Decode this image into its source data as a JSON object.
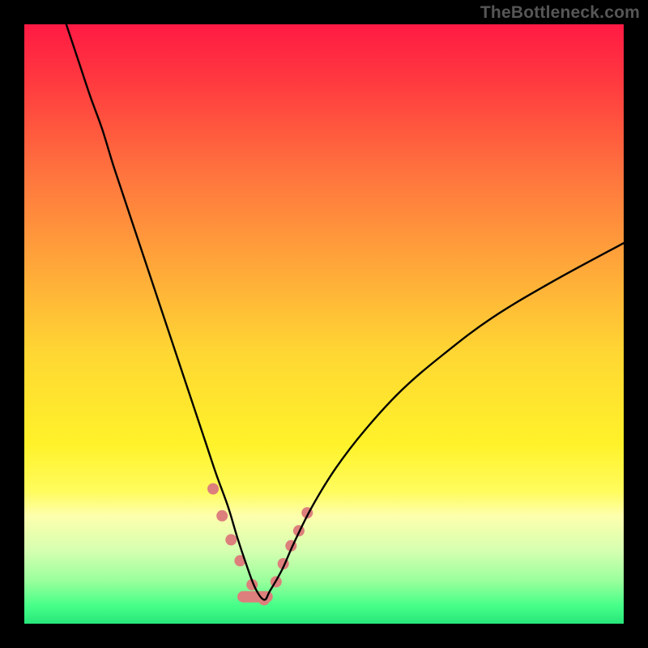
{
  "attribution": "TheBottleneck.com",
  "chart_data": {
    "type": "line",
    "title": "",
    "xlabel": "",
    "ylabel": "",
    "xlim": [
      0,
      100
    ],
    "ylim": [
      0,
      100
    ],
    "grid": false,
    "legend": false,
    "background": {
      "type": "vertical-gradient",
      "stops": [
        {
          "pos": 0.0,
          "color": "#ff1a44"
        },
        {
          "pos": 0.1,
          "color": "#ff3b3f"
        },
        {
          "pos": 0.25,
          "color": "#ff743e"
        },
        {
          "pos": 0.4,
          "color": "#ffa63a"
        },
        {
          "pos": 0.55,
          "color": "#ffd733"
        },
        {
          "pos": 0.7,
          "color": "#fff22a"
        },
        {
          "pos": 0.78,
          "color": "#fffc5e"
        },
        {
          "pos": 0.82,
          "color": "#fdffad"
        },
        {
          "pos": 0.88,
          "color": "#d4ffb0"
        },
        {
          "pos": 0.93,
          "color": "#97ff9b"
        },
        {
          "pos": 0.97,
          "color": "#46ff88"
        },
        {
          "pos": 1.0,
          "color": "#28e67a"
        }
      ]
    },
    "series": [
      {
        "name": "bottleneck-curve",
        "color": "#000000",
        "stroke_width": 2.4,
        "x": [
          7.0,
          9.0,
          11.0,
          13.0,
          15.0,
          18.0,
          21.0,
          24.0,
          27.0,
          30.0,
          32.0,
          34.0,
          35.5,
          37.0,
          38.5,
          40.0,
          41.0,
          43.0,
          45.0,
          48.0,
          52.0,
          57.0,
          63.0,
          70.0,
          78.0,
          88.0,
          100.0
        ],
        "y": [
          100.0,
          94.0,
          88.0,
          82.5,
          76.0,
          67.0,
          58.0,
          49.0,
          40.0,
          31.0,
          25.0,
          19.5,
          14.5,
          10.0,
          6.0,
          4.0,
          5.5,
          9.0,
          13.5,
          19.5,
          26.0,
          32.5,
          39.0,
          45.0,
          51.0,
          57.0,
          63.5
        ]
      },
      {
        "name": "optimal-range-marker",
        "color": "#dd7f7c",
        "stroke_width": 14,
        "segments": [
          {
            "x": [
              31.5,
              33.0,
              34.5,
              36.0,
              38.0,
              40.0
            ],
            "y": [
              22.5,
              18.0,
              14.0,
              10.5,
              6.5,
              4.0
            ]
          },
          {
            "x": [
              42.0,
              43.2,
              44.5,
              45.8,
              47.2
            ],
            "y": [
              7.0,
              10.0,
              13.0,
              15.5,
              18.5
            ]
          }
        ]
      }
    ]
  }
}
